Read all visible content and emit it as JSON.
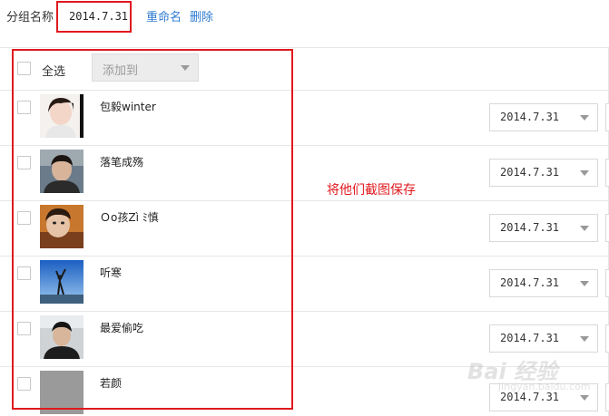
{
  "header": {
    "group_name_label": "分组名称",
    "group_name_value": "2014.7.31",
    "rename_label": "重命名",
    "delete_label": "删除"
  },
  "toolbar": {
    "select_all_label": "全选",
    "add_to_placeholder": "添加到"
  },
  "friends": [
    {
      "name": "包毅winter",
      "group": "2014.7.31"
    },
    {
      "name": "落笔成殇",
      "group": "2014.7.31"
    },
    {
      "name": "Ｏo孩Zì ﾐ慎",
      "group": "2014.7.31"
    },
    {
      "name": "听寒",
      "group": "2014.7.31"
    },
    {
      "name": "最爱偷吃",
      "group": "2014.7.31"
    },
    {
      "name": "若颜",
      "group": "2014.7.31"
    }
  ],
  "annotation": {
    "note": "将他们截图保存"
  },
  "watermark": {
    "text": "Bai  经验",
    "sub": "jingyan.baidu.com"
  },
  "colors": {
    "annotation_red": "#e0191e",
    "link_blue": "#2d7bd0"
  }
}
